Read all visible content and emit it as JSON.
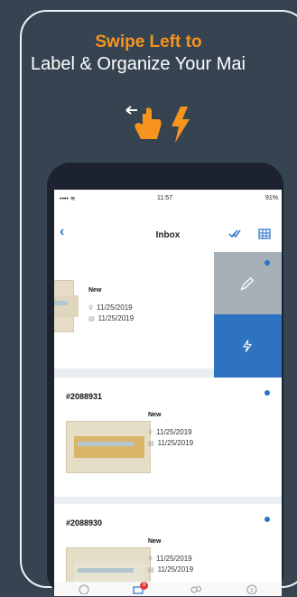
{
  "promo": {
    "headline": "Swipe Left to",
    "subline": "Label & Organize Your Mai"
  },
  "colors": {
    "accent": "#f7941d",
    "brand_blue": "#2e73c0",
    "background": "#364451"
  },
  "status_bar": {
    "time": "11:57",
    "battery": "91%",
    "signal": "•••• ≋"
  },
  "navbar": {
    "back": "‹",
    "title": "Inbox"
  },
  "mail_items": [
    {
      "id": "",
      "status": "New",
      "received": "11/25/2019",
      "scanned": "11/25/2019"
    },
    {
      "id": "#2088931",
      "status": "New",
      "received": "11/25/2019",
      "scanned": "11/25/2019"
    },
    {
      "id": "#2088930",
      "status": "New",
      "received": "11/25/2019",
      "scanned": "11/25/2019"
    }
  ],
  "swipe_actions": [
    {
      "name": "edit-label",
      "icon": "pencil-icon"
    },
    {
      "name": "quick-action",
      "icon": "lightning-icon"
    }
  ],
  "tab_bar": {
    "badge_count": "9"
  }
}
